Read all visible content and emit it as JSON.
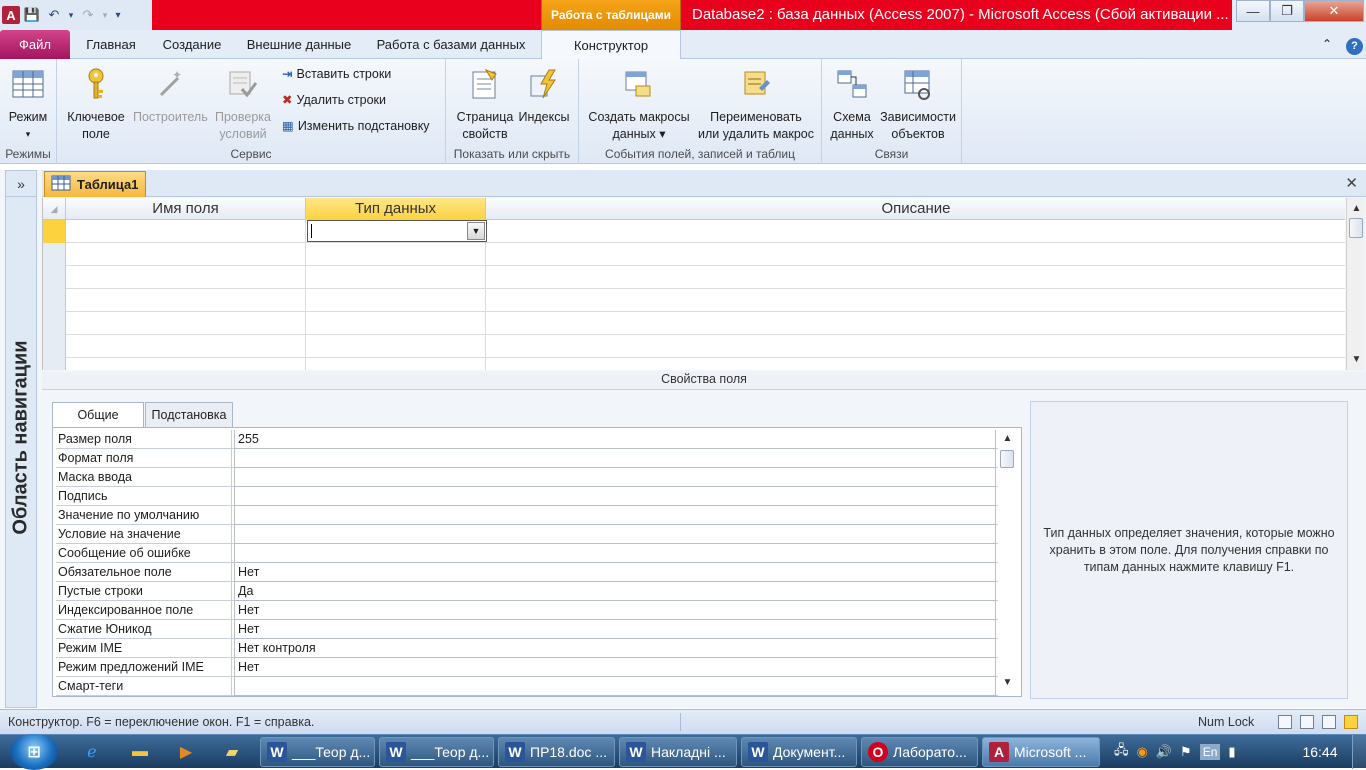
{
  "titlebar": {
    "context_tab": "Работа с таблицами",
    "window_title": "Database2 : база данных (Access 2007)  -  Microsoft Access (Сбой активации ...",
    "minimize": "—",
    "maximize": "❐",
    "close": "✕"
  },
  "qat": {
    "app_icon": "A",
    "save": "💾",
    "undo": "↶",
    "redo": "↷",
    "customize": "▾"
  },
  "tabs": {
    "file": "Файл",
    "home": "Главная",
    "create": "Создание",
    "external": "Внешние данные",
    "db_tools": "Работа с базами данных",
    "constructor": "Конструктор",
    "help_collapse": "⌃",
    "help": "?"
  },
  "ribbon": {
    "groups": {
      "modes": "Режимы",
      "service": "Сервис",
      "show_hide": "Показать или скрыть",
      "events": "События полей, записей и таблиц",
      "relations": "Связи"
    },
    "view": {
      "line1": "Режим",
      "line2": "▾"
    },
    "primary_key": {
      "line1": "Ключевое",
      "line2": "поле"
    },
    "builder": {
      "line1": "Построитель",
      "line2": ""
    },
    "test_rules": {
      "line1": "Проверка",
      "line2": "условий"
    },
    "insert_rows": "Вставить строки",
    "delete_rows": "Удалить строки",
    "modify_lookup": "Изменить подстановку",
    "property_sheet": {
      "line1": "Страница",
      "line2": "свойств"
    },
    "indexes": {
      "line1": "Индексы",
      "line2": ""
    },
    "create_macros": {
      "line1": "Создать макросы",
      "line2": "данных ▾"
    },
    "rename_macro": {
      "line1": "Переименовать",
      "line2": "или удалить макрос"
    },
    "relationships": {
      "line1": "Схема",
      "line2": "данных"
    },
    "dependencies": {
      "line1": "Зависимости",
      "line2": "объектов"
    }
  },
  "nav": {
    "toggle": "»",
    "title": "Область навигации"
  },
  "document": {
    "tab_label": "Таблица1",
    "close": "✕"
  },
  "design_grid": {
    "columns": [
      "Имя поля",
      "Тип данных",
      "Описание"
    ],
    "combo_arrow": "▼"
  },
  "field_properties": {
    "header": "Свойства поля",
    "tabs": [
      "Общие",
      "Подстановка"
    ],
    "rows": [
      {
        "label": "Размер поля",
        "value": "255"
      },
      {
        "label": "Формат поля",
        "value": ""
      },
      {
        "label": "Маска ввода",
        "value": ""
      },
      {
        "label": "Подпись",
        "value": ""
      },
      {
        "label": "Значение по умолчанию",
        "value": ""
      },
      {
        "label": "Условие на значение",
        "value": ""
      },
      {
        "label": "Сообщение об ошибке",
        "value": ""
      },
      {
        "label": "Обязательное поле",
        "value": "Нет"
      },
      {
        "label": "Пустые строки",
        "value": "Да"
      },
      {
        "label": "Индексированное поле",
        "value": "Нет"
      },
      {
        "label": "Сжатие Юникод",
        "value": "Нет"
      },
      {
        "label": "Режим IME",
        "value": "Нет контроля"
      },
      {
        "label": "Режим предложений IME",
        "value": "Нет"
      },
      {
        "label": "Смарт-теги",
        "value": ""
      }
    ],
    "help_text": "Тип данных определяет значения, которые можно хранить в этом поле. Для получения справки по типам данных нажмите клавишу F1."
  },
  "statusbar": {
    "text": "Конструктор.  F6 = переключение окон.  F1 = справка.",
    "numlock": "Num Lock"
  },
  "taskbar": {
    "start": "⊞",
    "items": [
      {
        "icon": "W",
        "label": "___Теор д..."
      },
      {
        "icon": "W",
        "label": "___Теор д..."
      },
      {
        "icon": "W",
        "label": "ПР18.doc ..."
      },
      {
        "icon": "W",
        "label": "Накладні ..."
      },
      {
        "icon": "W",
        "label": "Документ..."
      },
      {
        "icon": "O",
        "label": "Лаборато..."
      },
      {
        "icon": "A",
        "label": "Microsoft ..."
      }
    ],
    "lang": "En",
    "clock": "16:44"
  },
  "colors": {
    "accent_red": "#e8001c",
    "context_orange": "#f6a419",
    "file_tab": "#b41a6a",
    "selection_yellow": "#fcd23f"
  }
}
